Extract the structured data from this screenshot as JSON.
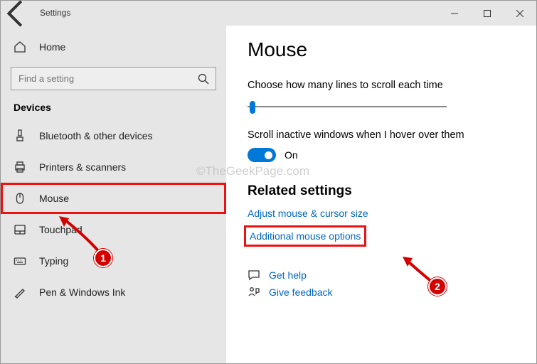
{
  "window": {
    "title": "Settings"
  },
  "sidebar": {
    "home": "Home",
    "searchPlaceholder": "Find a setting",
    "section": "Devices",
    "items": [
      {
        "label": "Bluetooth & other devices"
      },
      {
        "label": "Printers & scanners"
      },
      {
        "label": "Mouse"
      },
      {
        "label": "Touchpad"
      },
      {
        "label": "Typing"
      },
      {
        "label": "Pen & Windows Ink"
      }
    ]
  },
  "main": {
    "title": "Mouse",
    "scrollLinesLabel": "Choose how many lines to scroll each time",
    "hoverLabel": "Scroll inactive windows when I hover over them",
    "toggleState": "On",
    "relatedHeading": "Related settings",
    "links": {
      "adjust": "Adjust mouse & cursor size",
      "additional": "Additional mouse options"
    },
    "help": {
      "getHelp": "Get help",
      "feedback": "Give feedback"
    }
  },
  "watermark": "©TheGeekPage.com",
  "annotations": {
    "badge1": "1",
    "badge2": "2"
  }
}
